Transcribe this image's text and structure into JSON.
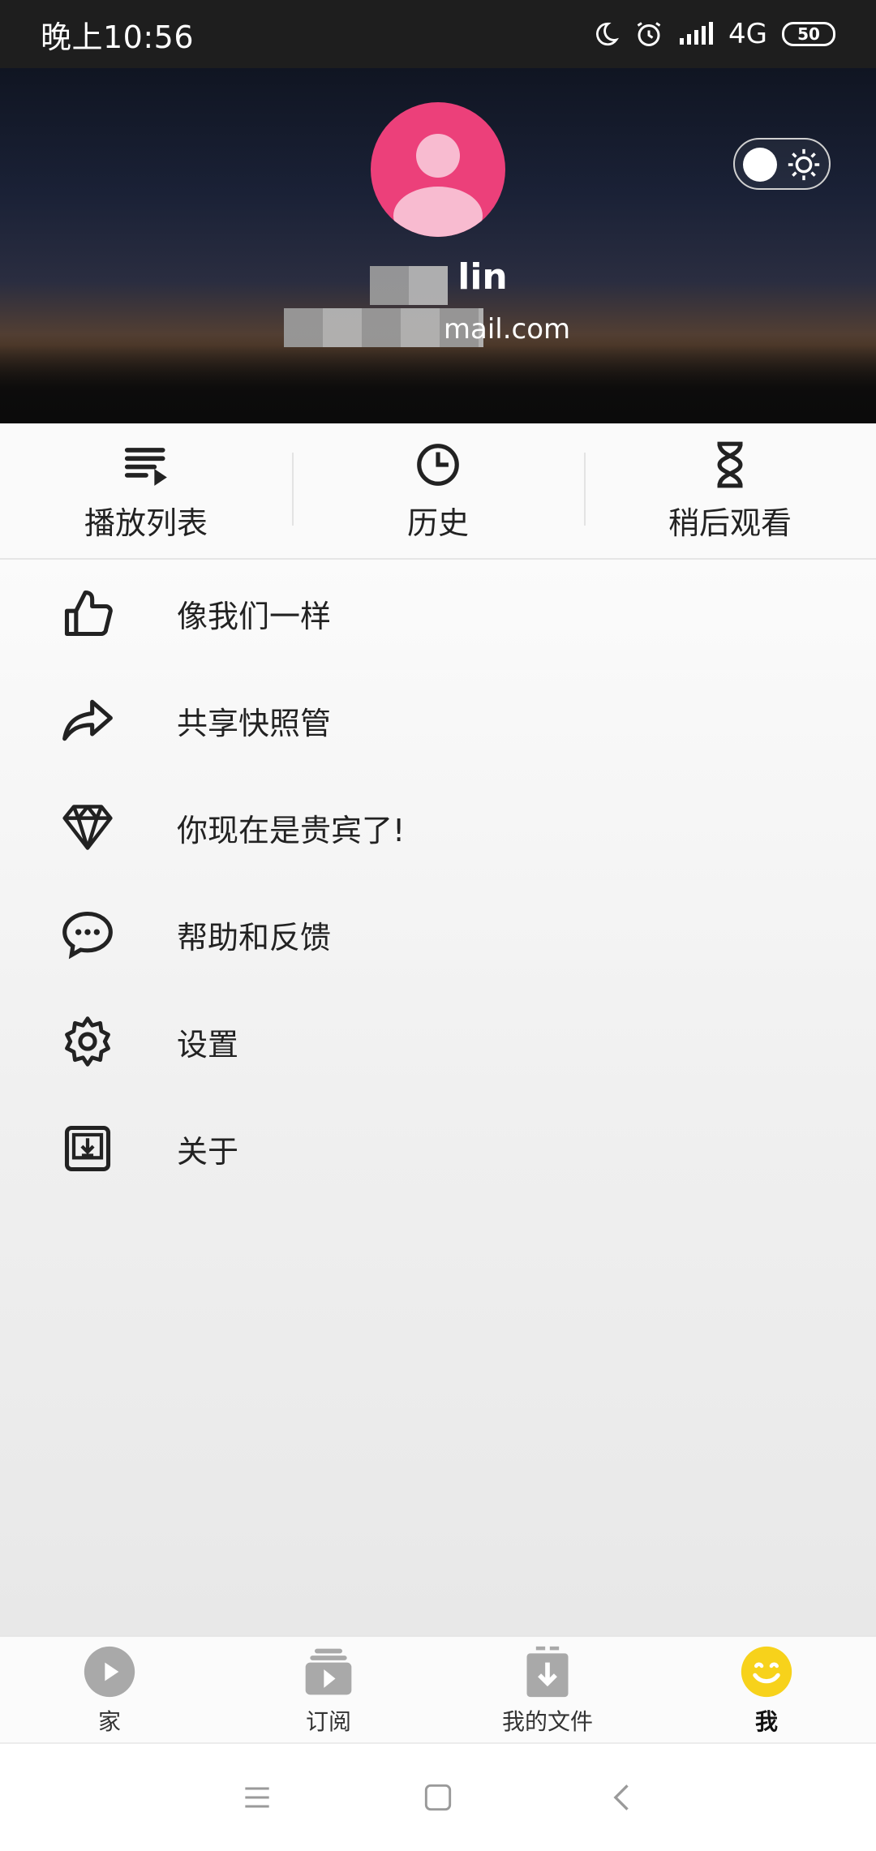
{
  "status_bar": {
    "time": "晚上10:56",
    "network": "4G",
    "battery": "50"
  },
  "profile": {
    "name": "lin",
    "email": "mail.com",
    "avatar_color": "#ec407a"
  },
  "quick_actions": [
    {
      "label": "播放列表",
      "icon": "playlist-icon"
    },
    {
      "label": "历史",
      "icon": "clock-icon"
    },
    {
      "label": "稍后观看",
      "icon": "hourglass-icon"
    }
  ],
  "menu": [
    {
      "label": "像我们一样",
      "icon": "thumbs-up-icon"
    },
    {
      "label": "共享快照管",
      "icon": "share-icon"
    },
    {
      "label": "你现在是贵宾了!",
      "icon": "diamond-icon"
    },
    {
      "label": "帮助和反馈",
      "icon": "chat-bubble-icon"
    },
    {
      "label": "设置",
      "icon": "gear-icon"
    },
    {
      "label": "关于",
      "icon": "about-download-icon"
    }
  ],
  "bottom_nav": [
    {
      "label": "家",
      "icon": "home-play-icon",
      "active": false
    },
    {
      "label": "订阅",
      "icon": "subscriptions-icon",
      "active": false
    },
    {
      "label": "我的文件",
      "icon": "downloads-icon",
      "active": false
    },
    {
      "label": "我",
      "icon": "smiley-icon",
      "active": true
    }
  ],
  "colors": {
    "accent_yellow": "#f7d21b",
    "inactive_icon": "#a9a9a9"
  }
}
